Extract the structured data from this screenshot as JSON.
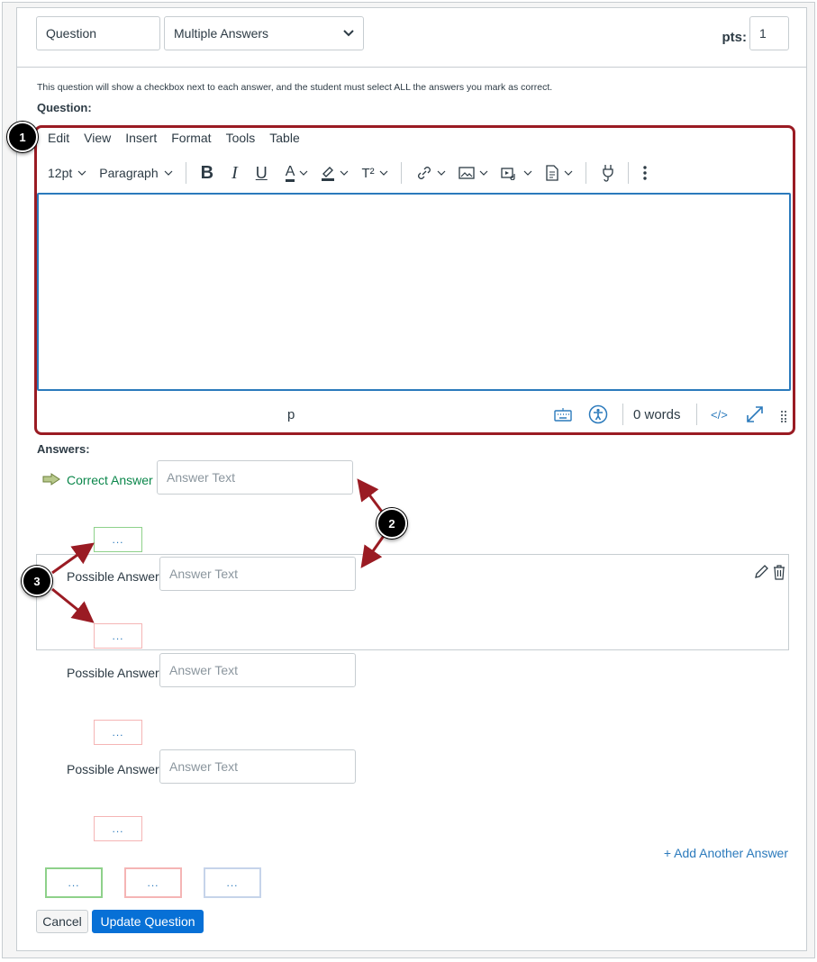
{
  "header": {
    "title_value": "Question",
    "type_select": "Multiple Answers",
    "pts_label": "pts:",
    "pts_value": "1"
  },
  "help_text": "This question will show a checkbox next to each answer, and the student must select ALL the answers you mark as correct.",
  "question_label": "Question:",
  "editor": {
    "menu": [
      "Edit",
      "View",
      "Insert",
      "Format",
      "Tools",
      "Table"
    ],
    "font_size": "12pt",
    "block_format": "Paragraph",
    "status_path": "p",
    "word_count": "0 words",
    "html_toggle": "</>"
  },
  "answers_label": "Answers:",
  "answers": [
    {
      "label": "Correct Answer",
      "placeholder": "Answer Text"
    },
    {
      "label": "Possible Answer",
      "placeholder": "Answer Text"
    },
    {
      "label": "Possible Answer",
      "placeholder": "Answer Text"
    },
    {
      "label": "Possible Answer",
      "placeholder": "Answer Text"
    }
  ],
  "comment_placeholder": "...",
  "add_answer": "+ Add Another Answer",
  "buttons": {
    "cancel": "Cancel",
    "update": "Update Question"
  },
  "callouts": [
    "1",
    "2",
    "3"
  ],
  "colors": {
    "accent": "#2b7abc",
    "callout_frame": "#9a1b23",
    "correct_green": "#0b874b",
    "primary_button": "#0770d6"
  }
}
